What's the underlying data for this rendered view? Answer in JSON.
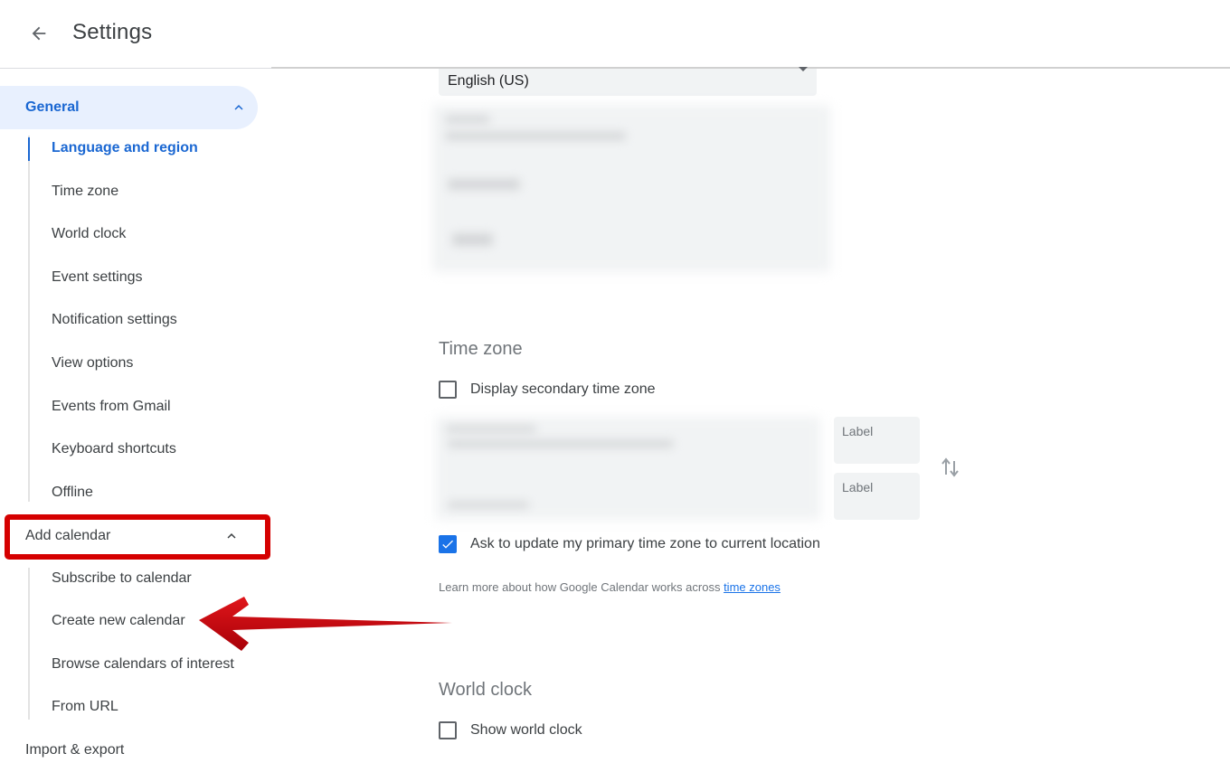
{
  "header": {
    "title": "Settings",
    "back_icon": "arrow-left-icon"
  },
  "sidebar": {
    "groups": [
      {
        "label": "General",
        "expanded": true,
        "active": true,
        "items": [
          {
            "label": "Language and region",
            "active": true
          },
          {
            "label": "Time zone"
          },
          {
            "label": "World clock"
          },
          {
            "label": "Event settings"
          },
          {
            "label": "Notification settings"
          },
          {
            "label": "View options"
          },
          {
            "label": "Events from Gmail"
          },
          {
            "label": "Keyboard shortcuts"
          },
          {
            "label": "Offline"
          }
        ]
      },
      {
        "label": "Add calendar",
        "expanded": true,
        "highlighted": true,
        "items": [
          {
            "label": "Subscribe to calendar"
          },
          {
            "label": "Create new calendar"
          },
          {
            "label": "Browse calendars of interest"
          },
          {
            "label": "From URL"
          }
        ]
      },
      {
        "label": "Import & export"
      }
    ]
  },
  "main": {
    "language_select": {
      "value": "English (US)"
    },
    "time_zone": {
      "title": "Time zone",
      "secondary_checkbox": {
        "label": "Display secondary time zone",
        "checked": false
      },
      "label_fields": [
        {
          "placeholder": "Label"
        },
        {
          "placeholder": "Label"
        }
      ],
      "swap_icon": "swap-vertical-icon",
      "update_checkbox": {
        "label": "Ask to update my primary time zone to current location",
        "checked": true
      },
      "learn_more_text": "Learn more about how Google Calendar works across ",
      "learn_more_link": "time zones"
    },
    "world_clock": {
      "title": "World clock",
      "show_checkbox": {
        "label": "Show world clock",
        "checked": false
      }
    }
  },
  "annotation": {
    "highlight_color": "#d50000",
    "arrow_target": "Create new calendar"
  },
  "colors": {
    "accent": "#1a67d2",
    "active_bg": "#e8f0fe",
    "checkbox_checked": "#1a73e8"
  }
}
